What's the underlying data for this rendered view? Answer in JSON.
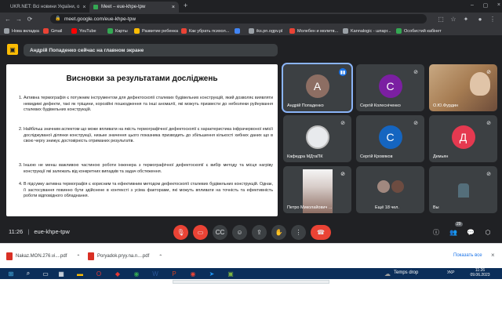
{
  "browser": {
    "tabs": [
      {
        "title": "UKR.NET: Всі новини України, о",
        "active": false
      },
      {
        "title": "Meet – eue-khpe-tpw",
        "active": true
      }
    ],
    "new_tab": "+",
    "url": "meet.google.com/eue-khpe-tpw",
    "bookmarks": [
      {
        "label": "Нова вкладка",
        "color": "#9aa0a6"
      },
      {
        "label": "Gmail",
        "color": "#ea4335"
      },
      {
        "label": "YouTube",
        "color": "#ff0000"
      },
      {
        "label": "Карты",
        "color": "#34a853"
      },
      {
        "label": "Развитие ребенка",
        "color": "#fbbc04"
      },
      {
        "label": "Как убрать психол...",
        "color": "#ea4335"
      },
      {
        "label": "",
        "color": "#4285f4"
      },
      {
        "label": "iks.pn.ogpv.pl",
        "color": "#9aa0a6"
      },
      {
        "label": "Молебен и молитв...",
        "color": "#ea4335"
      },
      {
        "label": "Kannalogic - шпарг...",
        "color": "#9aa0a6"
      },
      {
        "label": "Особистий кабінет",
        "color": "#34a853"
      }
    ]
  },
  "meet": {
    "banner": "Андрій Попаденко сейчас на главном экране",
    "slide": {
      "title": "Висновки за результатами досліджень",
      "paragraphs": [
        {
          "num": "1.",
          "text": "Активна термографія є потужним інструментом для дефектоскопії сталевих будівельних конструкцій, який дозволяє виявляти невидимі дефекти, такі як тріщини, корозійні пошкодження та інші аномалії, які можуть призвести до небезпеки руйнування сталевих будівельних конструкцій."
        },
        {
          "num": "2.",
          "text": "Найбільш значним аспектом що може впливати на якість термографічної дефектоскопії є характеристика інфрачервоної емісії досліджуваної ділянки конструкції, низьке значення цього показника призводить до збільшення кількості хибних даних що в свою чергу знижує достовірність отриманих результатів."
        },
        {
          "num": "3.",
          "text": "Іншою не менш важливою частиною роботи інженера з термографічної дефектоскопії є вибір методу та місця нагріву конструкції які залежать від конкретних випадків та задач обстеження."
        },
        {
          "num": "4.",
          "text": "В підсумку активна термографія є корисним та ефективним методом дефектоскопії сталевих будівельних конструкцій. Однак, її застосування повинно бути здійснене в контексті з усіма факторами, які можуть впливати на точність та ефективність роботи відповідного обладнання."
        }
      ]
    },
    "participants": [
      {
        "name": "Андрій Попаденко",
        "initial": "А",
        "color": "#8d6e63",
        "speaking": true
      },
      {
        "name": "Сергій Колесніченко",
        "initial": "С",
        "color": "#7b1fa2",
        "speaking": false
      },
      {
        "name": "О.Ю.Фурдин",
        "initial": "",
        "color": "#8d6e63",
        "speaking": false
      },
      {
        "name": "Кафедра МДтаПК",
        "initial": "",
        "color": "#e8eaed",
        "speaking": false
      },
      {
        "name": "Сергій Кровяков",
        "initial": "С",
        "color": "#1565c0",
        "speaking": false
      },
      {
        "name": "Демьян",
        "initial": "Д",
        "color": "#e53950",
        "speaking": false
      },
      {
        "name": "Петро Миколайович ...",
        "initial": "",
        "color": "#9e9e9e",
        "speaking": false
      },
      {
        "name": "Ещё 18 чел.",
        "initial": "",
        "color": "#5f6368",
        "speaking": false
      },
      {
        "name": "Вы",
        "initial": "",
        "color": "#5f6368",
        "speaking": false
      }
    ],
    "time": "11:26",
    "separator": "|",
    "meeting_code": "eue-khpe-tpw",
    "participants_badge": "29"
  },
  "downloads": {
    "files": [
      {
        "name": "Nakaz.MON.276.vi....pdf"
      },
      {
        "name": "Poryadok.pryy.na.n....pdf"
      }
    ],
    "show_all": "Показать все"
  },
  "taskbar": {
    "weather": "Temps drop",
    "lang": "УКР",
    "clock_time": "11:26",
    "clock_date": "09.06.2023"
  }
}
